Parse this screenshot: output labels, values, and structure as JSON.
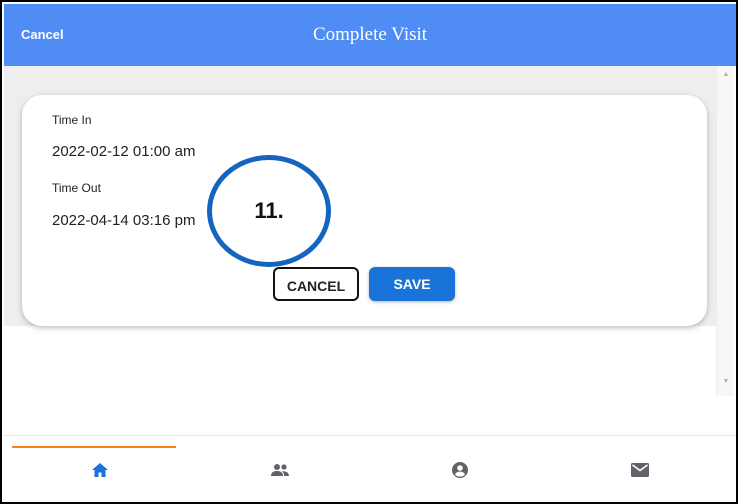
{
  "header": {
    "cancel_label": "Cancel",
    "title": "Complete Visit"
  },
  "form": {
    "time_in_label": "Time In",
    "time_in_value": "2022-02-12 01:00 am",
    "time_out_label": "Time Out",
    "time_out_value": "2022-04-14 03:16 pm",
    "cancel_button": "CANCEL",
    "save_button": "SAVE"
  },
  "annotation": {
    "step_label": "11."
  },
  "bottom_nav": {
    "items": [
      {
        "icon": "home-icon",
        "active": true
      },
      {
        "icon": "people-icon",
        "active": false
      },
      {
        "icon": "account-icon",
        "active": false
      },
      {
        "icon": "mail-icon",
        "active": false
      }
    ]
  },
  "colors": {
    "header": "#4f8df5",
    "primary_button": "#1a73d9",
    "active_nav": "#1a73d9",
    "inactive_nav": "#5f6368",
    "nav_indicator": "#f5821f",
    "annotation_ring": "#1565c0"
  }
}
